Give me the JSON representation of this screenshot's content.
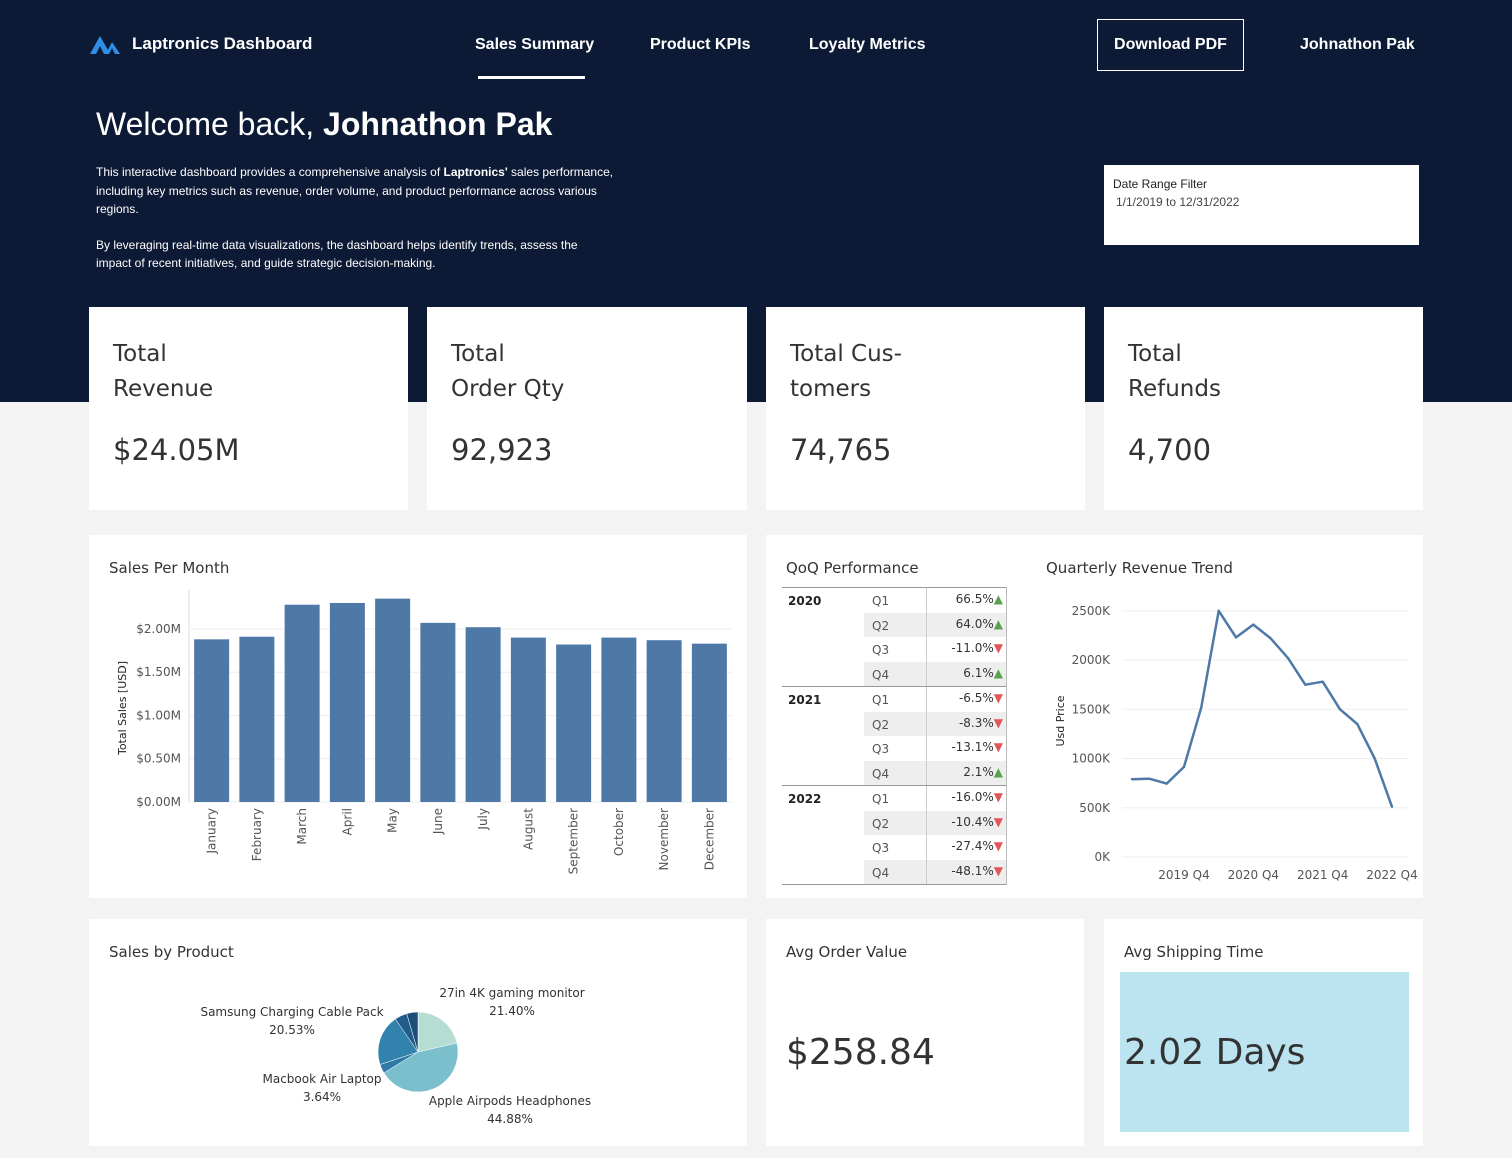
{
  "app": {
    "title": "Laptronics Dashboard"
  },
  "nav": {
    "tabs": [
      {
        "label": "Sales Summary"
      },
      {
        "label": "Product KPIs"
      },
      {
        "label": "Loyalty Metrics"
      }
    ],
    "active_tab": "Sales Summary",
    "download_label": "Download PDF",
    "user_name": "Johnathon Pak"
  },
  "welcome": {
    "prefix": "Welcome back, ",
    "name": "Johnathon Pak"
  },
  "intro": {
    "p1_a": "This interactive dashboard provides a comprehensive analysis of ",
    "p1_brand": "Laptronics'",
    "p1_b": " sales performance, including key metrics such as revenue, order volume, and product performance across various regions.",
    "p2": "By leveraging real-time data visualizations, the dashboard helps identify trends, assess the impact of recent initiatives, and guide strategic decision-making."
  },
  "date_filter": {
    "label": "Date Range Filter",
    "value": "1/1/2019 to 12/31/2022"
  },
  "kpis": [
    {
      "label_line1": "Total",
      "label_line2": "Revenue",
      "value": "$24.05M"
    },
    {
      "label_line1": "Total",
      "label_line2": "Order Qty",
      "value": "92,923"
    },
    {
      "label_line1": "Total Cus-",
      "label_line2": "tomers",
      "value": "74,765"
    },
    {
      "label_line1": "Total",
      "label_line2": "Refunds",
      "value": "4,700"
    }
  ],
  "panels": {
    "sales_per_month": "Sales Per Month",
    "qoq": "QoQ Performance",
    "quarterly_trend": "Quarterly Revenue Trend",
    "sales_by_product": "Sales by Product",
    "avg_order": {
      "title": "Avg Order Value",
      "value": "$258.84"
    },
    "avg_shipping": {
      "title": "Avg Shipping Time",
      "value": "2.02 Days"
    }
  },
  "qoq_table": [
    {
      "year": "2020",
      "rows": [
        {
          "q": "Q1",
          "val": "66.5%",
          "dir": "up"
        },
        {
          "q": "Q2",
          "val": "64.0%",
          "dir": "up"
        },
        {
          "q": "Q3",
          "val": "-11.0%",
          "dir": "down"
        },
        {
          "q": "Q4",
          "val": "6.1%",
          "dir": "up"
        }
      ]
    },
    {
      "year": "2021",
      "rows": [
        {
          "q": "Q1",
          "val": "-6.5%",
          "dir": "down"
        },
        {
          "q": "Q2",
          "val": "-8.3%",
          "dir": "down"
        },
        {
          "q": "Q3",
          "val": "-13.1%",
          "dir": "down"
        },
        {
          "q": "Q4",
          "val": "2.1%",
          "dir": "up"
        }
      ]
    },
    {
      "year": "2022",
      "rows": [
        {
          "q": "Q1",
          "val": "-16.0%",
          "dir": "down"
        },
        {
          "q": "Q2",
          "val": "-10.4%",
          "dir": "down"
        },
        {
          "q": "Q3",
          "val": "-27.4%",
          "dir": "down"
        },
        {
          "q": "Q4",
          "val": "-48.1%",
          "dir": "down"
        }
      ]
    }
  ],
  "colors": {
    "navy": "#0d1a35",
    "bar": "#4e79a7",
    "up": "#59a14f",
    "down": "#e15759",
    "shipping": "#bce4f0"
  },
  "chart_data": [
    {
      "type": "bar",
      "title": "Sales Per Month",
      "ylabel": "Total Sales [USD]",
      "categories": [
        "January",
        "February",
        "March",
        "April",
        "May",
        "June",
        "July",
        "August",
        "September",
        "October",
        "November",
        "December"
      ],
      "values": [
        1.88,
        1.91,
        2.28,
        2.3,
        2.35,
        2.07,
        2.02,
        1.9,
        1.82,
        1.9,
        1.87,
        1.83
      ],
      "unit": "M USD",
      "yticks": [
        "$0.00M",
        "$0.50M",
        "$1.00M",
        "$1.50M",
        "$2.00M"
      ],
      "ytick_values": [
        0,
        0.5,
        1.0,
        1.5,
        2.0
      ],
      "ylim": [
        0,
        2.45
      ]
    },
    {
      "type": "line",
      "title": "Quarterly Revenue Trend",
      "ylabel": "Usd Price",
      "x": [
        "2019 Q1",
        "2019 Q2",
        "2019 Q3",
        "2019 Q4",
        "2020 Q1",
        "2020 Q2",
        "2020 Q3",
        "2020 Q4",
        "2021 Q1",
        "2021 Q2",
        "2021 Q3",
        "2021 Q4",
        "2022 Q1",
        "2022 Q2",
        "2022 Q3",
        "2022 Q4"
      ],
      "values": [
        790,
        795,
        745,
        915,
        1520,
        2500,
        2230,
        2360,
        2220,
        2020,
        1750,
        1780,
        1500,
        1350,
        1000,
        510
      ],
      "unit": "K USD",
      "xticks": [
        "2019 Q4",
        "2020 Q4",
        "2021 Q4",
        "2022 Q4"
      ],
      "yticks": [
        "0K",
        "500K",
        "1000K",
        "1500K",
        "2000K",
        "2500K"
      ],
      "ytick_values": [
        0,
        500,
        1000,
        1500,
        2000,
        2500
      ],
      "ylim": [
        0,
        2600
      ]
    },
    {
      "type": "pie",
      "title": "Sales by Product",
      "slices": [
        {
          "label": "27in 4K gaming monitor",
          "pct": "21.40%",
          "value": 21.4,
          "color": "#b5ddd4"
        },
        {
          "label": "Apple Airpods Headphones",
          "pct": "44.88%",
          "value": 44.88,
          "color": "#7bbfcd"
        },
        {
          "label": "Macbook Air Laptop",
          "pct": "3.64%",
          "value": 3.64,
          "color": "#2e79a6"
        },
        {
          "label": "Samsung Charging Cable Pack",
          "pct": "20.53%",
          "value": 20.53,
          "color": "#3182ad"
        },
        {
          "label": "",
          "pct": "",
          "value": 5.0,
          "color": "#225c8a"
        },
        {
          "label": "",
          "pct": "",
          "value": 4.55,
          "color": "#1c4e7a"
        }
      ]
    }
  ]
}
